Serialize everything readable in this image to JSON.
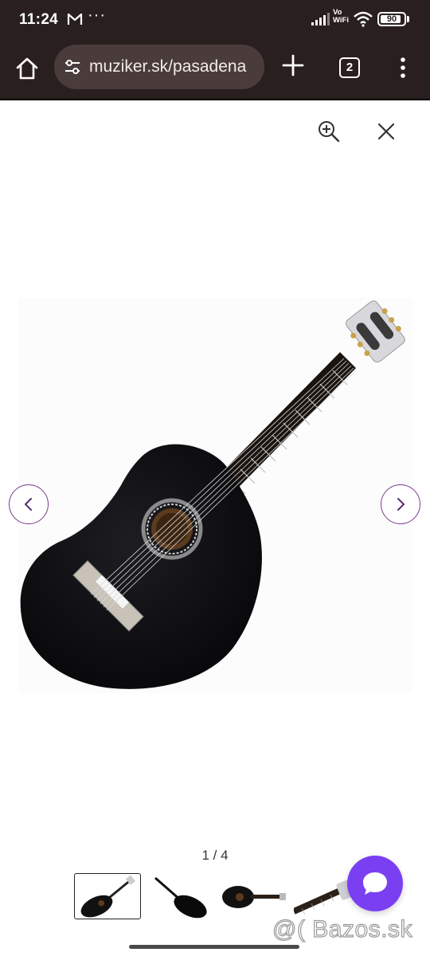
{
  "status_bar": {
    "time": "11:24",
    "network_label_line1": "Vo",
    "network_label_line2": "WiFi",
    "battery": "90",
    "battery_level": 0.9,
    "overflow": "···"
  },
  "browser": {
    "url": "muziker.sk/pasadena",
    "tab_count": "2"
  },
  "gallery": {
    "counter": "1 / 4",
    "current_index": 1,
    "total": 4,
    "accent_color": "#7a3b8f",
    "chat_color": "#7b3ff2"
  },
  "watermark": "@( Bazos.sk",
  "icons": {
    "home": "home-icon",
    "site_info": "tune-icon",
    "new_tab": "plus-icon",
    "menu": "more-vert-icon",
    "zoom": "zoom-in-icon",
    "close": "close-icon",
    "prev": "chevron-left-icon",
    "next": "chevron-right-icon",
    "chat": "chat-bubble-icon"
  }
}
